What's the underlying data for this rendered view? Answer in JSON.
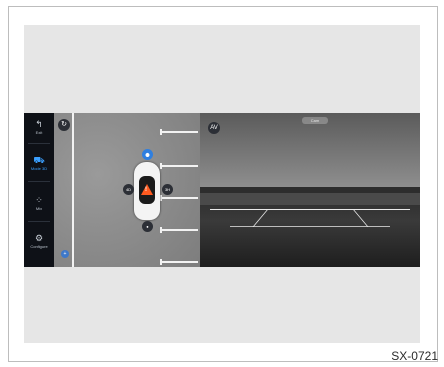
{
  "sidebar": {
    "items": [
      {
        "label": "Exit",
        "icon": "back-arrow-icon",
        "active": false
      },
      {
        "label": "Mode 3D",
        "icon": "car-3d-icon",
        "active": true
      },
      {
        "label": "Mix",
        "icon": "mix-view-icon",
        "active": false
      },
      {
        "label": "Configure",
        "icon": "gear-icon",
        "active": false
      }
    ]
  },
  "top_view": {
    "rotate_icon": "↻",
    "warning_symbol": "!",
    "camera_buttons": {
      "front": "⬤",
      "left": "4D",
      "right": "3H",
      "rear": "●"
    },
    "blue_marker": "+"
  },
  "rear_view": {
    "label": "Cam",
    "icon_text": "AV"
  },
  "figure_code": "SX-0721",
  "colors": {
    "accent": "#3ba0ff",
    "warning": "#ff5a1f",
    "sidebar_bg": "#0e1117"
  }
}
